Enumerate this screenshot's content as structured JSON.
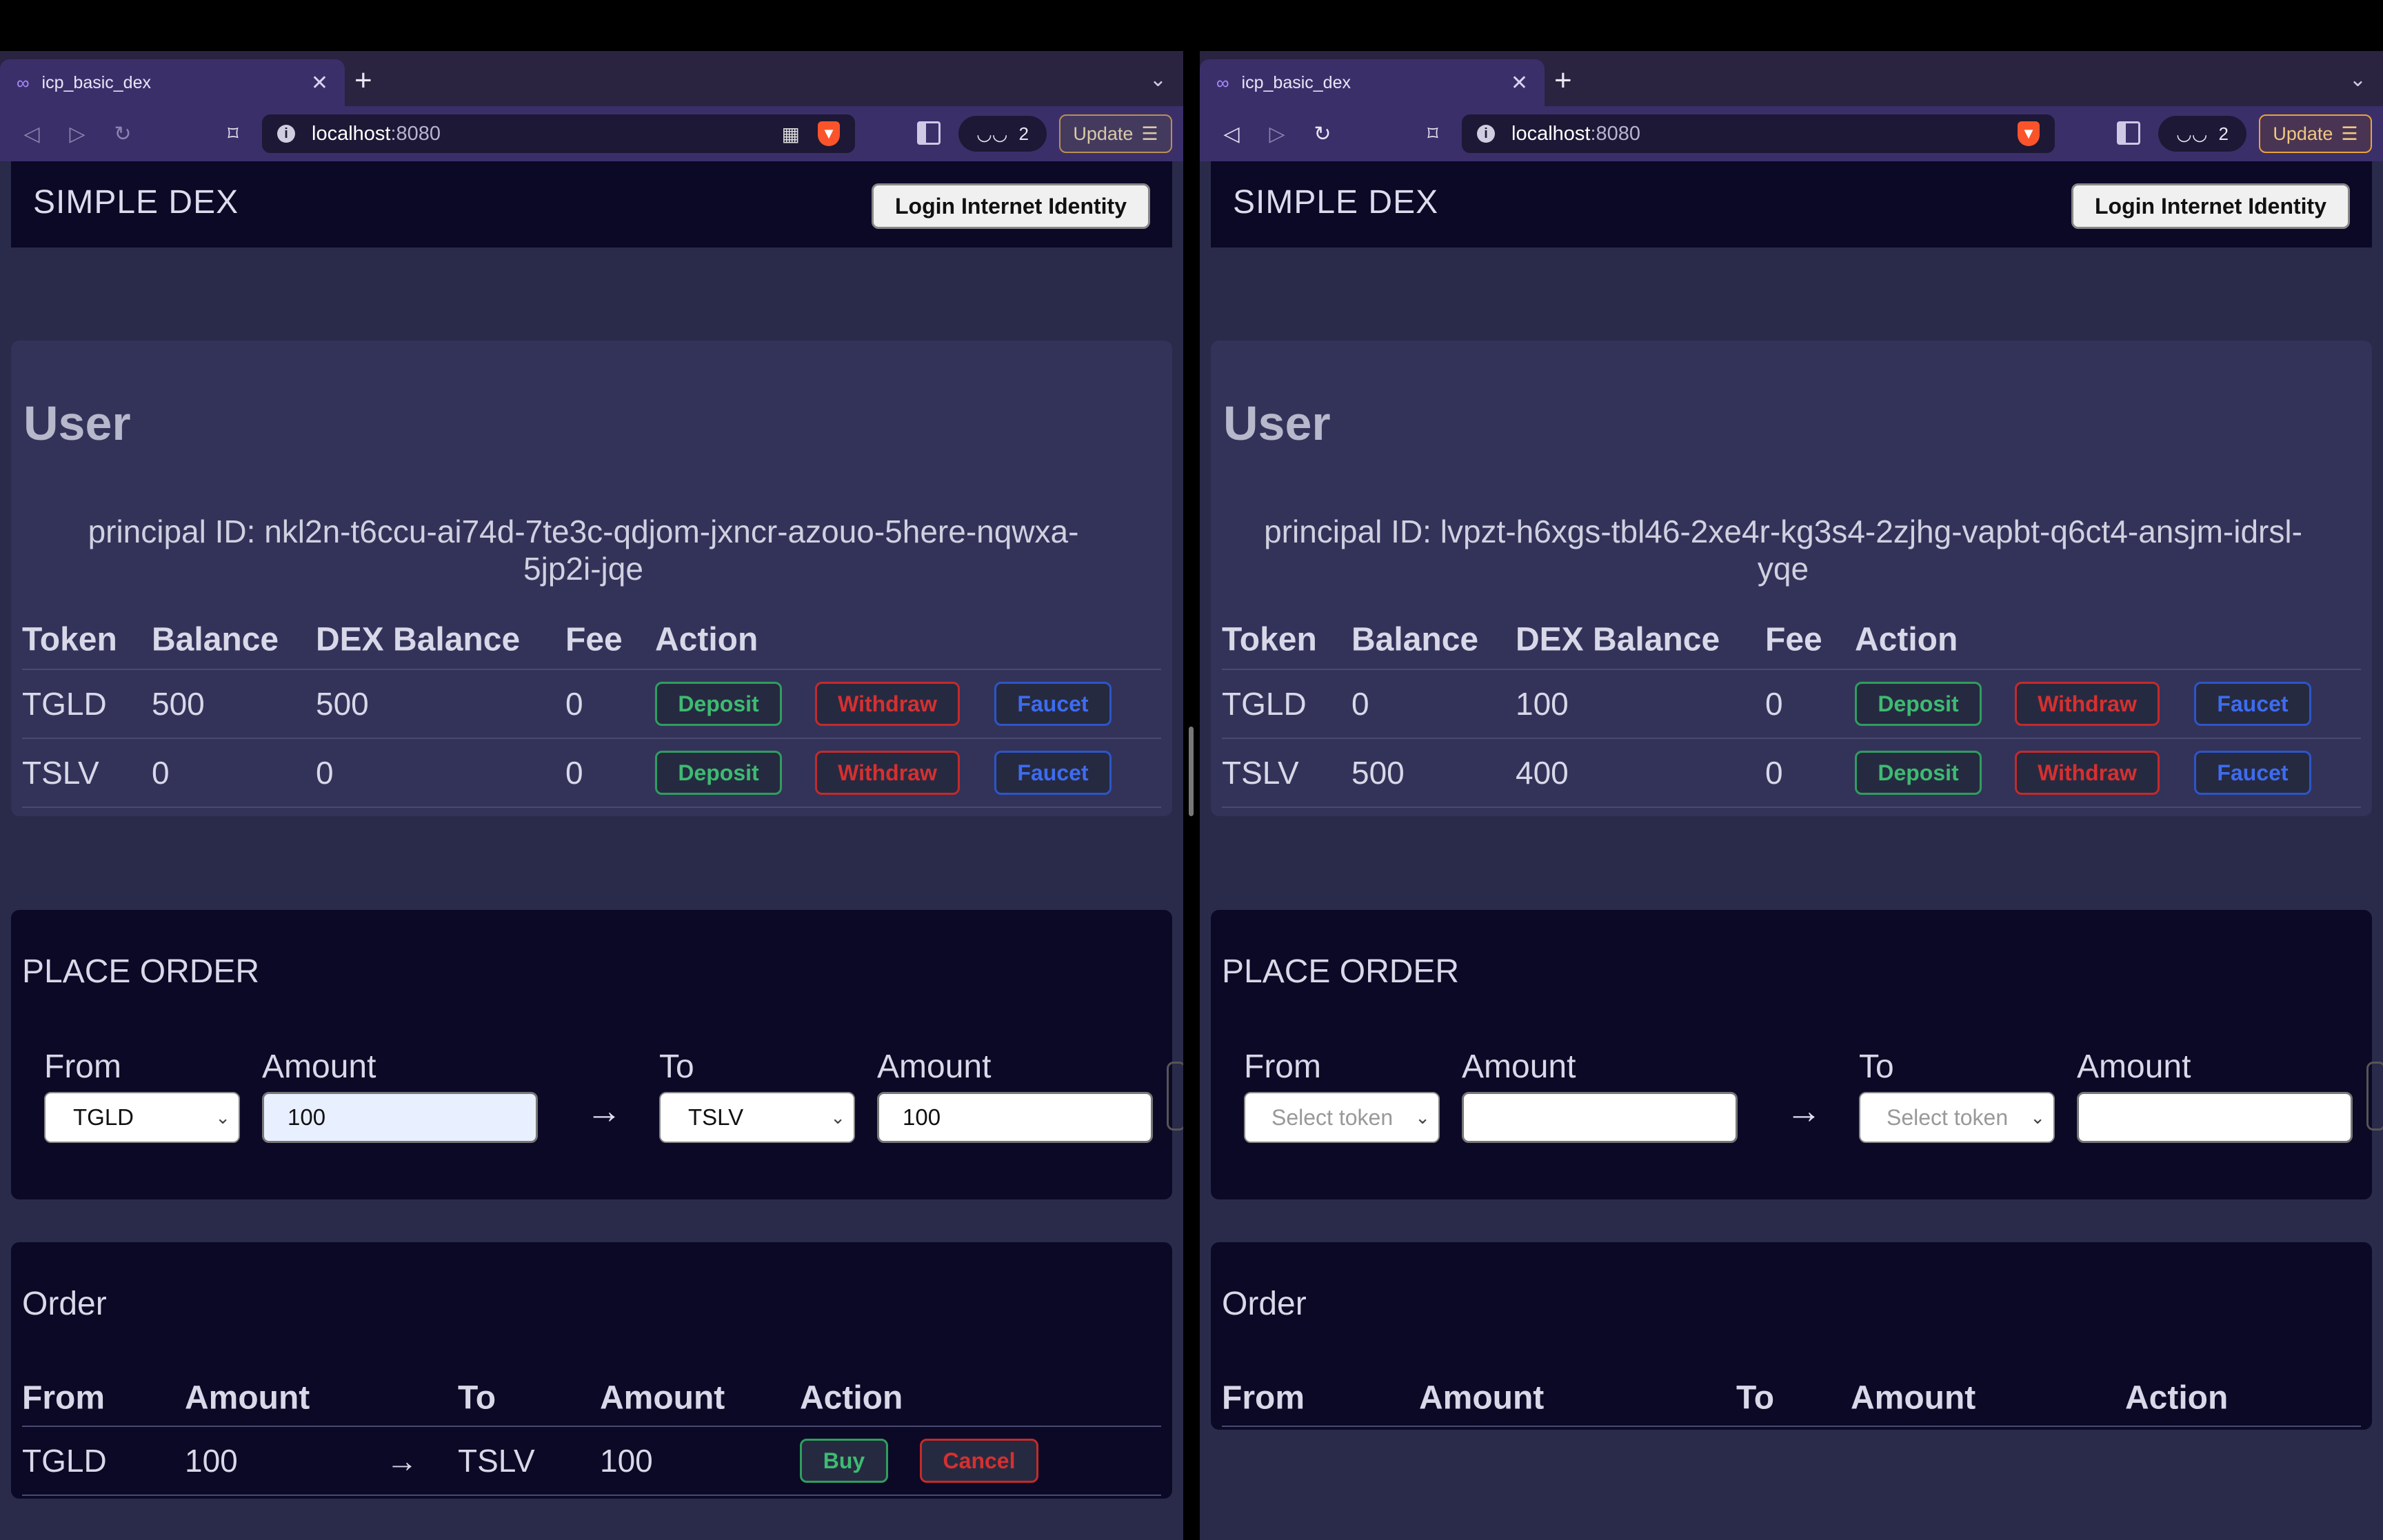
{
  "left": {
    "tab": {
      "title": "icp_basic_dex"
    },
    "url": {
      "host": "localhost",
      "port": ":8080"
    },
    "vpn_count": "2",
    "update_label": "Update",
    "header": {
      "logo": "SIMPLE DEX",
      "login_label": "Login Internet Identity"
    },
    "user": {
      "title": "User",
      "principal": "principal ID: nkl2n-t6ccu-ai74d-7te3c-qdjom-jxncr-azouo-5here-nqwxa-5jp2i-jqe",
      "columns": [
        "Token",
        "Balance",
        "DEX Balance",
        "Fee",
        "Action"
      ],
      "rows": [
        {
          "token": "TGLD",
          "balance": "500",
          "dex_balance": "500",
          "fee": "0"
        },
        {
          "token": "TSLV",
          "balance": "0",
          "dex_balance": "0",
          "fee": "0"
        }
      ],
      "actions": {
        "deposit": "Deposit",
        "withdraw": "Withdraw",
        "faucet": "Faucet"
      }
    },
    "place_order": {
      "title": "PLACE ORDER",
      "from_label": "From",
      "amount_label": "Amount",
      "to_label": "To",
      "from_value": "TGLD",
      "from_amount": "100",
      "to_value": "TSLV",
      "to_amount": "100",
      "arrow": "→"
    },
    "orders": {
      "title": "Order",
      "columns": [
        "From",
        "Amount",
        "To",
        "Amount",
        "Action"
      ],
      "rows": [
        {
          "from": "TGLD",
          "amount": "100",
          "arrow": "→",
          "to": "TSLV",
          "to_amount": "100",
          "buy": "Buy",
          "cancel": "Cancel"
        }
      ]
    }
  },
  "right": {
    "tab": {
      "title": "icp_basic_dex"
    },
    "url": {
      "host": "localhost",
      "port": ":8080"
    },
    "vpn_count": "2",
    "update_label": "Update",
    "header": {
      "logo": "SIMPLE DEX",
      "login_label": "Login Internet Identity"
    },
    "user": {
      "title": "User",
      "principal": "principal ID: lvpzt-h6xgs-tbl46-2xe4r-kg3s4-2zjhg-vapbt-q6ct4-ansjm-idrsl-yqe",
      "columns": [
        "Token",
        "Balance",
        "DEX Balance",
        "Fee",
        "Action"
      ],
      "rows": [
        {
          "token": "TGLD",
          "balance": "0",
          "dex_balance": "100",
          "fee": "0"
        },
        {
          "token": "TSLV",
          "balance": "500",
          "dex_balance": "400",
          "fee": "0"
        }
      ],
      "actions": {
        "deposit": "Deposit",
        "withdraw": "Withdraw",
        "faucet": "Faucet"
      }
    },
    "place_order": {
      "title": "PLACE ORDER",
      "from_label": "From",
      "amount_label": "Amount",
      "to_label": "To",
      "from_placeholder": "Select token",
      "to_placeholder": "Select token",
      "arrow": "→"
    },
    "orders": {
      "title": "Order",
      "columns": [
        "From",
        "Amount",
        "To",
        "Amount",
        "Action"
      ],
      "rows": []
    }
  },
  "icons": [
    "infinity-favicon-icon",
    "close-icon",
    "plus-icon",
    "chevron-down-icon",
    "back-icon",
    "forward-icon",
    "reload-icon",
    "bookmark-icon",
    "info-icon",
    "qr-icon",
    "brave-shield-icon",
    "sidebar-icon",
    "vpn-glasses-icon",
    "menu-icon"
  ],
  "colors": {
    "header_bg": "#0b0926",
    "page_bg": "#2a2a4a",
    "card_bg": "#33335a",
    "deposit": "#3dbb72",
    "withdraw": "#d63030",
    "faucet": "#3d6cf0"
  }
}
